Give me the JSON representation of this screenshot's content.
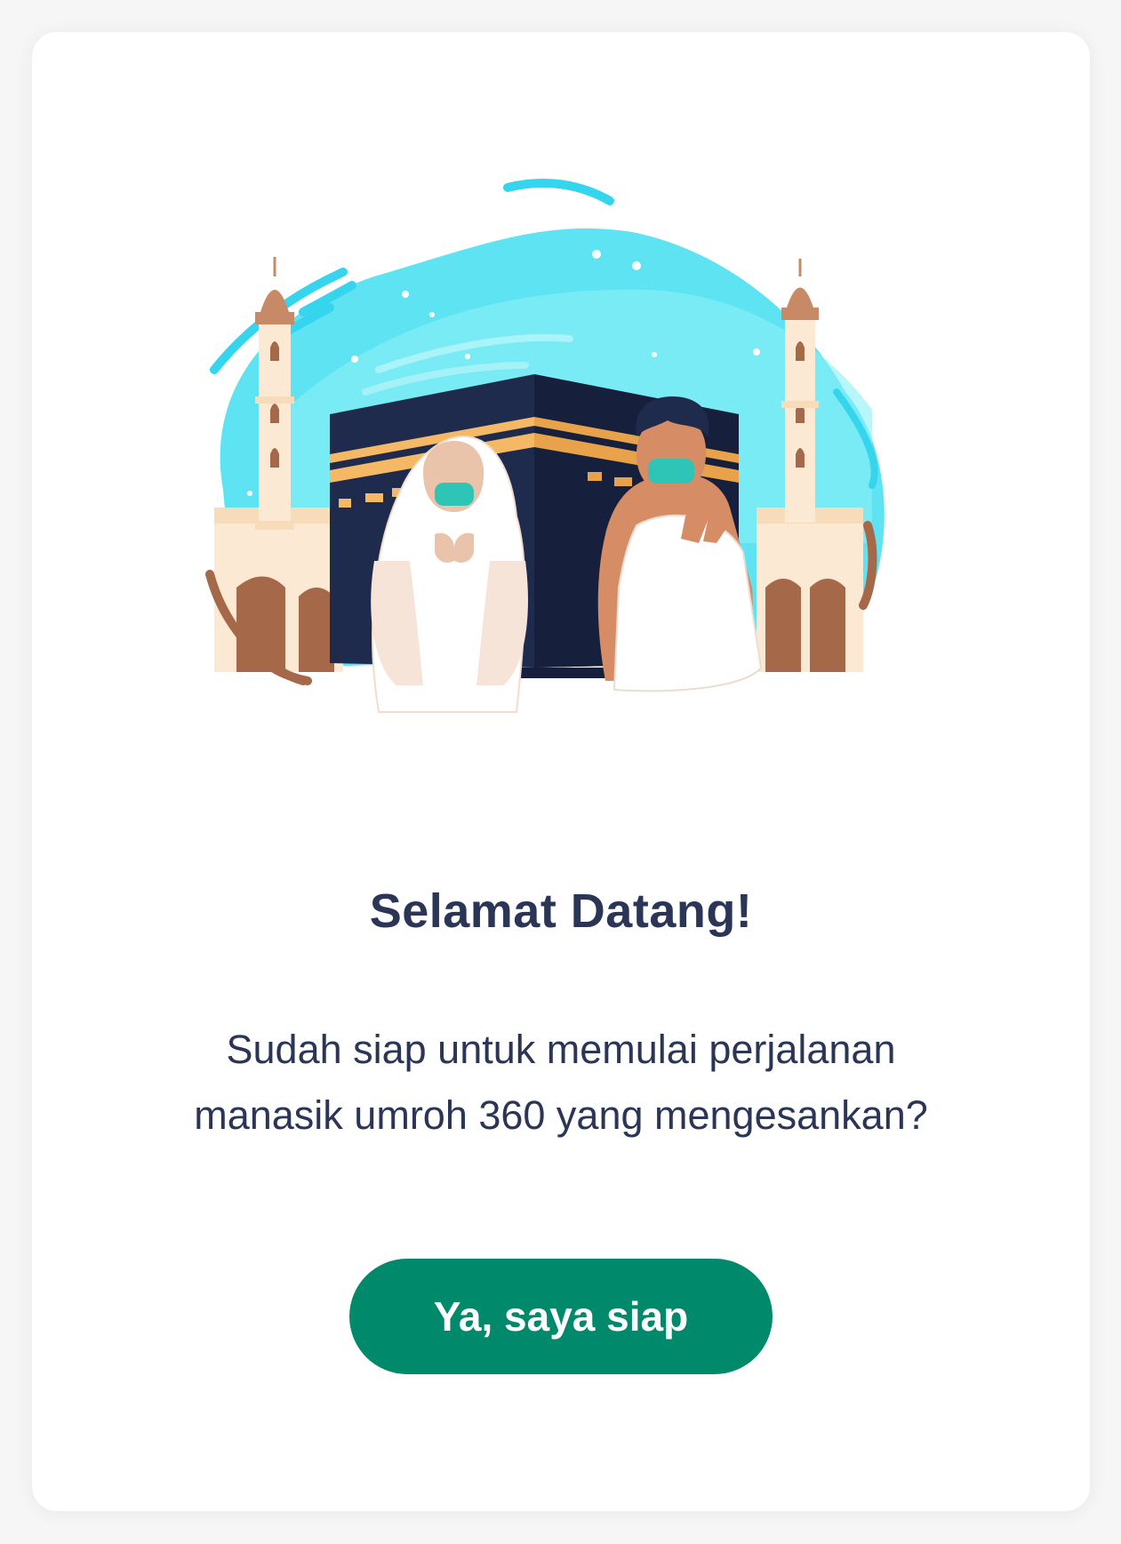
{
  "welcome": {
    "title": "Selamat Datang!",
    "subtitle_line1": "Sudah siap untuk memulai perjalanan",
    "subtitle_line2": "manasik umroh 360 yang mengesankan?",
    "cta_label": "Ya, saya siap"
  },
  "colors": {
    "accent": "#00896b",
    "text": "#2b3657",
    "sky": "#5ee3f3",
    "kaaba": "#1f2b4d",
    "gold": "#f5b865"
  }
}
